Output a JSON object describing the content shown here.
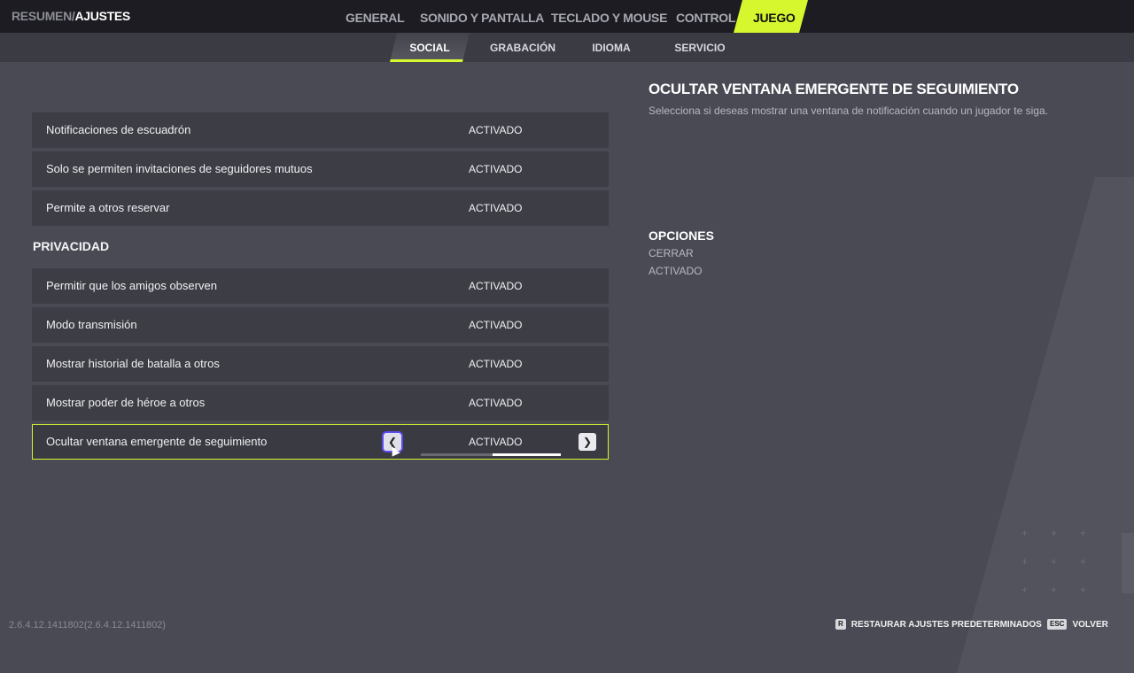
{
  "breadcrumb": {
    "parent": "RESUMEN/",
    "current": "AJUSTES"
  },
  "tabs": [
    {
      "label": "GENERAL"
    },
    {
      "label": "SONIDO Y PANTALLA"
    },
    {
      "label": "TECLADO Y MOUSE"
    },
    {
      "label": "CONTROL"
    },
    {
      "label": "JUEGO",
      "active": true
    }
  ],
  "subtabs": [
    {
      "label": "SOCIAL",
      "active": true
    },
    {
      "label": "GRABACIÓN"
    },
    {
      "label": "IDIOMA"
    },
    {
      "label": "SERVICIO"
    }
  ],
  "settings": [
    {
      "label": "Notificaciones de escuadrón",
      "value": "ACTIVADO"
    },
    {
      "label": "Solo se permiten invitaciones de seguidores mutuos",
      "value": "ACTIVADO"
    },
    {
      "label": "Permite a otros reservar",
      "value": "ACTIVADO"
    }
  ],
  "privacy": {
    "title": "PRIVACIDAD",
    "settings": [
      {
        "label": "Permitir que los amigos observen",
        "value": "ACTIVADO"
      },
      {
        "label": "Modo transmisión",
        "value": "ACTIVADO"
      },
      {
        "label": "Mostrar historial de batalla a otros",
        "value": "ACTIVADO"
      },
      {
        "label": "Mostrar poder de héroe a otros",
        "value": "ACTIVADO"
      },
      {
        "label": "Ocultar ventana emergente de seguimiento",
        "value": "ACTIVADO",
        "selected": true,
        "option_index": 2,
        "option_count": 2
      }
    ]
  },
  "detail": {
    "title": "OCULTAR VENTANA EMERGENTE DE SEGUIMIENTO",
    "description": "Selecciona si deseas mostrar una ventana de notificación cuando un jugador te siga.",
    "options_title": "OPCIONES",
    "options": [
      "CERRAR",
      "ACTIVADO"
    ]
  },
  "footer": {
    "version": "2.6.4.12.1411802(2.6.4.12.1411802)",
    "restore": {
      "key": "R",
      "label": "RESTAURAR AJUSTES PREDETERMINADOS"
    },
    "back": {
      "key": "ESC",
      "label": "VOLVER"
    }
  },
  "colors": {
    "accent": "#d6f72e",
    "background": "#4a4a55",
    "row": "#3d3d46",
    "topbar": "#1c1c22"
  },
  "icons": {
    "left": "chevron-left-icon",
    "right": "chevron-right-icon"
  }
}
